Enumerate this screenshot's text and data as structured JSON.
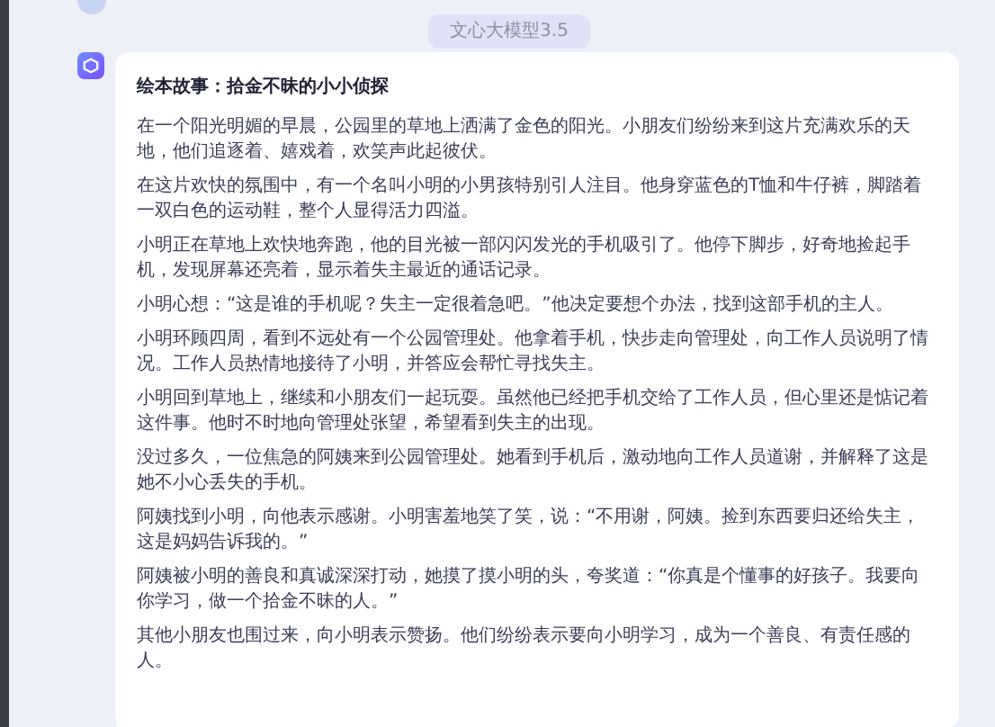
{
  "model_badge": "文心大模型3.5",
  "answer": {
    "title": "绘本故事：拾金不昧的小小侦探",
    "paragraphs": [
      "在一个阳光明媚的早晨，公园里的草地上洒满了金色的阳光。小朋友们纷纷来到这片充满欢乐的天地，他们追逐着、嬉戏着，欢笑声此起彼伏。",
      "在这片欢快的氛围中，有一个名叫小明的小男孩特别引人注目。他身穿蓝色的T恤和牛仔裤，脚踏着一双白色的运动鞋，整个人显得活力四溢。",
      "小明正在草地上欢快地奔跑，他的目光被一部闪闪发光的手机吸引了。他停下脚步，好奇地捡起手机，发现屏幕还亮着，显示着失主最近的通话记录。",
      "小明心想：“这是谁的手机呢？失主一定很着急吧。”他决定要想个办法，找到这部手机的主人。",
      "小明环顾四周，看到不远处有一个公园管理处。他拿着手机，快步走向管理处，向工作人员说明了情况。工作人员热情地接待了小明，并答应会帮忙寻找失主。",
      "小明回到草地上，继续和小朋友们一起玩耍。虽然他已经把手机交给了工作人员，但心里还是惦记着这件事。他时不时地向管理处张望，希望看到失主的出现。",
      "没过多久，一位焦急的阿姨来到公园管理处。她看到手机后，激动地向工作人员道谢，并解释了这是她不小心丢失的手机。",
      "阿姨找到小明，向他表示感谢。小明害羞地笑了笑，说：“不用谢，阿姨。捡到东西要归还给失主，这是妈妈告诉我的。”",
      "阿姨被小明的善良和真诚深深打动，她摸了摸小明的头，夸奖道：“你真是个懂事的好孩子。我要向你学习，做一个拾金不昧的人。”",
      "其他小朋友也围过来，向小明表示赞扬。他们纷纷表示要向小明学习，成为一个善良、有责任感的人。"
    ]
  }
}
